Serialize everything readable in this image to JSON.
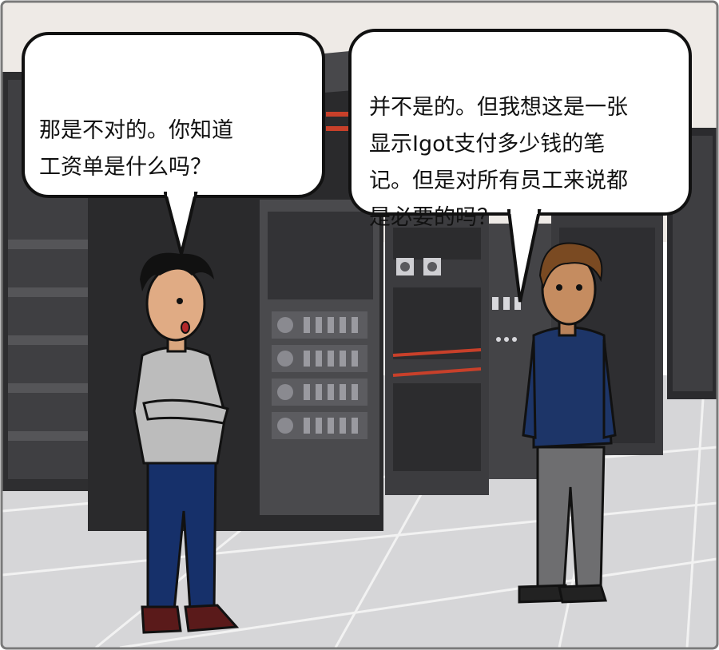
{
  "speech": {
    "left": "那是不对的。你知道\n工资单是什么吗？",
    "right": "并不是的。但我想这是一张\n显示Igot支付多少钱的笔\n记。但是对所有员工来说都\n是必要的吗？"
  },
  "colors": {
    "wall": "#eeeae6",
    "floor": "#d6d6d8",
    "rack": "#3a3a3c",
    "rack_dark": "#2a2a2c",
    "accent_red": "#c8402a",
    "outline": "#111111"
  }
}
